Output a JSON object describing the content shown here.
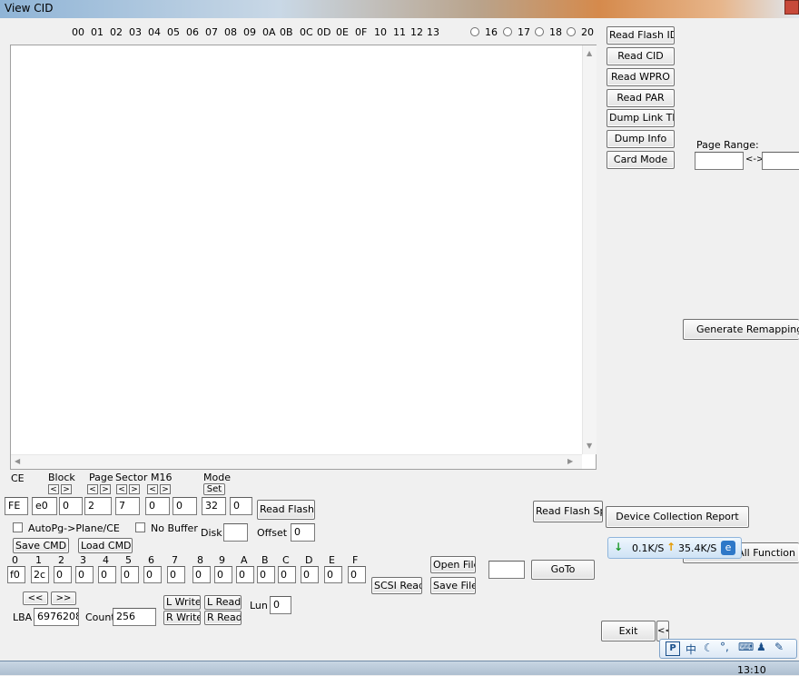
{
  "window": {
    "title": "View CID"
  },
  "hex_header": [
    "00",
    "01",
    "02",
    "03",
    "04",
    "05",
    "06",
    "07",
    "08",
    "09",
    "0A",
    "0B",
    "0C",
    "0D",
    "0E",
    "0F",
    "10",
    "11",
    "12",
    "13"
  ],
  "radio_options": [
    "16",
    "17",
    "18",
    "20"
  ],
  "right_buttons": [
    "Read Flash ID",
    "Read CID",
    "Read WPRO",
    "Read PAR",
    "Dump Link Tbl",
    "Dump Info",
    "Card Mode"
  ],
  "page_range": {
    "label": "Page Range:",
    "separator": "<->",
    "start": "",
    "end": ""
  },
  "generate_remap_label": "Generate Remapping ta",
  "fields_labels": {
    "ce": "CE",
    "block": "Block",
    "page": "Page",
    "sector": "Sector",
    "m16": "M16",
    "mode": "Mode"
  },
  "mode_set_label": "Set",
  "nav_lt": "<",
  "nav_gt": ">",
  "field_values": {
    "ce": "FE",
    "block": "e0",
    "block2": "0",
    "page": "2",
    "sector": "7",
    "m16_a": "0",
    "m16_b": "0",
    "mode": "32",
    "mode2": "0"
  },
  "read_flash_label": "Read Flash",
  "read_flash_spr_label": "Read Flash Spr",
  "device_report_label": "Device Collection Report",
  "all_function_label": "All Function",
  "autopg_label": "AutoPg->Plane/CE",
  "nobuffer_label": "No Buffer",
  "disk_label": "Disk",
  "disk_value": "",
  "offset_label": "Offset",
  "offset_value": "0",
  "save_cmd_label": "Save CMD",
  "load_cmd_label": "Load CMD",
  "cmd_headers": [
    "0",
    "1",
    "2",
    "3",
    "4",
    "5",
    "6",
    "7",
    "8",
    "9",
    "A",
    "B",
    "C",
    "D",
    "E",
    "F"
  ],
  "cmd_values": [
    "f0",
    "2c",
    "0",
    "0",
    "0",
    "0",
    "0",
    "0",
    "0",
    "0",
    "0",
    "0",
    "0",
    "0",
    "0",
    "0"
  ],
  "open_file_label": "Open File",
  "save_file_label": "Save File",
  "scsi_read_label": "SCSI Read",
  "goto_value": "",
  "goto_label": "GoTo",
  "prev_label": "<<",
  "next_label": ">>",
  "lba_label": "LBA",
  "lba_value": "6976208",
  "count_label": "Count",
  "count_value": "256",
  "l_write_label": "L Write",
  "l_read_label": "L Read",
  "r_write_label": "R Write",
  "r_read_label": "R Read",
  "lun_label": "Lun",
  "lun_value": "0",
  "exit_label": "Exit",
  "collapse_label": "<<",
  "net_speed": {
    "down": "0.1K/S",
    "up": "35.4K/S"
  },
  "ime_char": "中",
  "clock": "13:10"
}
